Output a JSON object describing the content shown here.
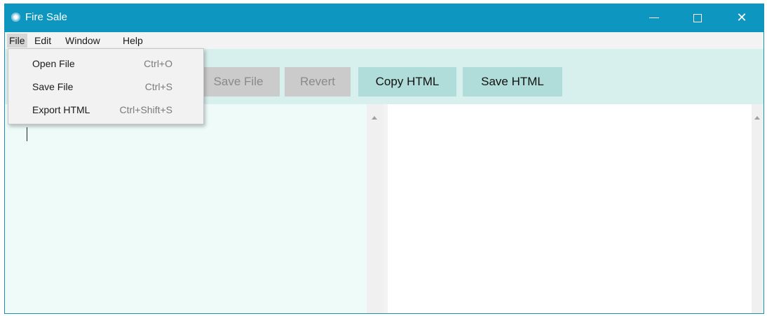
{
  "window": {
    "title": "Fire Sale",
    "minimize_icon": "minimize-icon",
    "maximize_icon": "maximize-icon",
    "close_icon": "close-icon",
    "close_glyph": "✕"
  },
  "menubar": {
    "items": [
      {
        "label": "File",
        "active": true
      },
      {
        "label": "Edit"
      },
      {
        "label": "Window"
      },
      {
        "label": "Help"
      }
    ]
  },
  "file_menu": {
    "items": [
      {
        "label": "Open File",
        "shortcut": "Ctrl+O"
      },
      {
        "label": "Save File",
        "shortcut": "Ctrl+S"
      },
      {
        "label": "Export HTML",
        "shortcut": "Ctrl+Shift+S"
      }
    ]
  },
  "toolbar": {
    "buttons": [
      {
        "label": "Save File",
        "enabled": false
      },
      {
        "label": "Revert",
        "enabled": false
      },
      {
        "label": "Copy HTML",
        "enabled": true
      },
      {
        "label": "Save HTML",
        "enabled": true
      }
    ]
  },
  "colors": {
    "titlebar": "#0c96c0",
    "toolbar": "#d7efed",
    "editor": "#eefbf9",
    "button_enabled": "#b0ddd9",
    "button_disabled": "#cbcbcb"
  }
}
